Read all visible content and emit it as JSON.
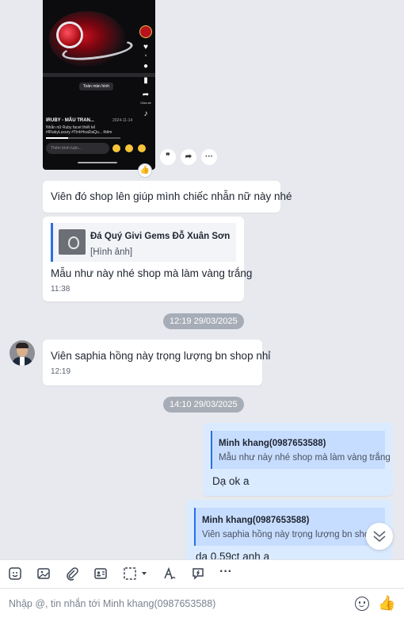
{
  "video_card": {
    "full_screen_label": "Toàn màn hình",
    "title": "IRUBY - MẪU TRAN...",
    "date": "2024-11-14",
    "desc_line1": "Nhẫn nữ Ruby facet thiết kế",
    "desc_line2": "#IRubyLuxury #TinhHoaDaQu... thêm",
    "comment_placeholder": "Thêm bình luận...",
    "like_count": "6",
    "share_label": "Chia sẻ",
    "progress": 0.3
  },
  "message_actions": {
    "quote_icon": "quote-icon",
    "forward_icon": "share-arrow-icon",
    "more_label": "···"
  },
  "messages": {
    "m1": {
      "text": "Viên đó shop lên giúp mình chiếc nhẫn nữ này nhé"
    },
    "m2": {
      "quote_name": "Đá Quý Givi Gems Đỗ Xuân Sơn",
      "quote_text": "[Hình ảnh]",
      "text": "Mẫu như này nhé shop mà làm vàng trắng",
      "time": "11:38"
    },
    "sep1": "12:19 29/03/2025",
    "m3": {
      "text": "Viên saphia hồng này trọng lượng bn shop nhỉ",
      "time": "12:19"
    },
    "sep2": "14:10 29/03/2025",
    "m4": {
      "quote_name": "Minh khang(0987653588)",
      "quote_text": "Mẫu như này nhé shop mà làm vàng trắng",
      "text": "Dạ ok a"
    },
    "m5": {
      "quote_name": "Minh khang(0987653588)",
      "quote_text": "Viên saphia hồng này trọng lượng bn shop",
      "text": "da 0.59ct anh a"
    }
  },
  "composer": {
    "placeholder": "Nhập @, tin nhắn tới Minh khang(0987653588)",
    "more_label": "···",
    "colors": {
      "accent": "#2a6fe6",
      "sent_bubble": "#dbebff",
      "like": "#f2a900"
    }
  }
}
